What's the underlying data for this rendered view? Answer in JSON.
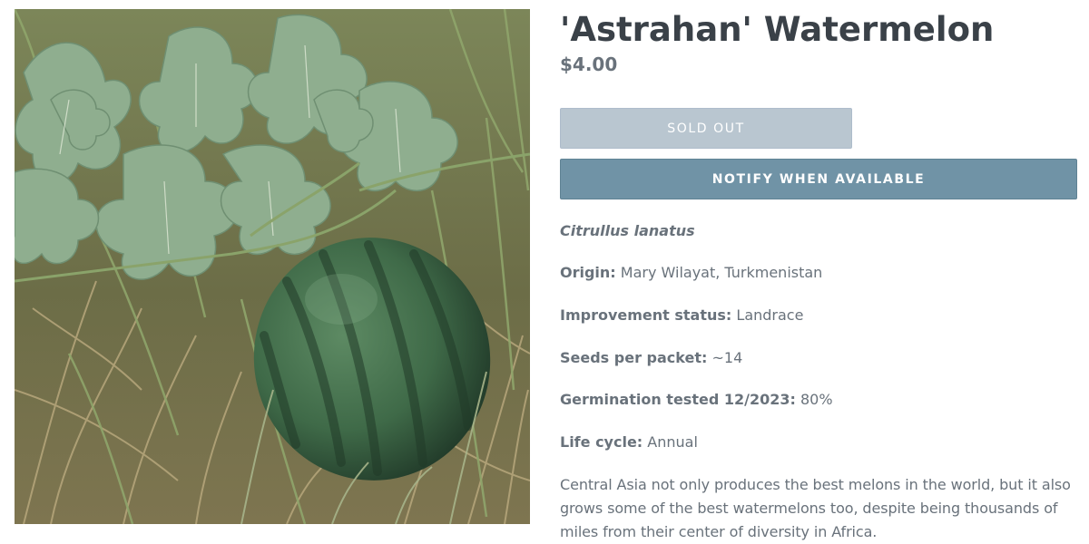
{
  "product": {
    "title": "'Astrahan' Watermelon",
    "price": "$4.00",
    "image_alt": "watermelon-in-grass-photo",
    "sold_out_label": "SOLD OUT",
    "notify_label": "NOTIFY WHEN AVAILABLE",
    "scientific_name": "Citrullus lanatus",
    "specs": [
      {
        "label": "Origin:",
        "value": "Mary Wilayat, Turkmenistan"
      },
      {
        "label": "Improvement status:",
        "value": "Landrace"
      },
      {
        "label": "Seeds per packet:",
        "value": "~14"
      },
      {
        "label": "Germination tested 12/2023:",
        "value": "80%"
      },
      {
        "label": "Life cycle:",
        "value": "Annual"
      }
    ],
    "description": "Central Asia not only produces the best melons in the world, but it also grows some of the best watermelons too, despite being thousands of miles from their center of diversity in Africa."
  },
  "colors": {
    "title": "#3a4148",
    "body_text": "#69727b",
    "sold_out_bg": "#b9c6d0",
    "notify_bg": "#7093a6"
  }
}
